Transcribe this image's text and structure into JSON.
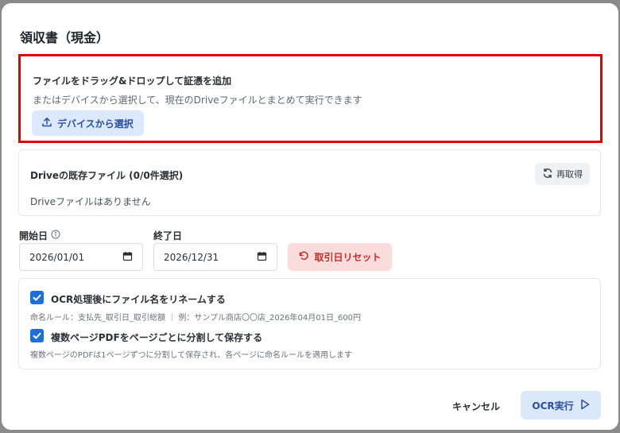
{
  "dialog": {
    "title": "領収書（現金）"
  },
  "dropzone": {
    "title": "ファイルをドラッグ&ドロップして証憑を追加",
    "subtitle": "またはデバイスから選択して、現在のDriveファイルとまとめて実行できます",
    "button_label": "デバイスから選択",
    "button_icon": "upload-icon",
    "highlight_color": "#e00000"
  },
  "drive": {
    "title": "Driveの既存ファイル (0/0件選択)",
    "empty_text": "Driveファイルはありません",
    "refetch_label": "再取得",
    "refetch_icon": "refresh-icon"
  },
  "dates": {
    "start_label": "開始日",
    "start_info_icon": "info-icon",
    "start_value": "2026/01/01",
    "end_label": "終了日",
    "end_value": "2026/12/31",
    "calendar_icon": "calendar-icon",
    "reset_label": "取引日リセット",
    "reset_icon": "undo-icon"
  },
  "options": {
    "rename": {
      "label": "OCR処理後にファイル名をリネームする",
      "checked": true,
      "description": "命名ルール：支払先_取引日_取引総額 ｜ 例：サンプル商店〇〇店_2026年04月01日_600円"
    },
    "split": {
      "label": "複数ページPDFをページごとに分割して保存する",
      "checked": true,
      "description": "複数ページのPDFは1ページずつに分割して保存され、各ページに命名ルールを適用します"
    }
  },
  "footer": {
    "cancel_label": "キャンセル",
    "ocr_label": "OCR実行",
    "ocr_icon": "play-icon"
  },
  "colors": {
    "primary": "#1f6fd6",
    "primary_soft": "#dce8fb",
    "danger_text": "#c42b2b",
    "danger_soft": "#fbdcdc"
  }
}
